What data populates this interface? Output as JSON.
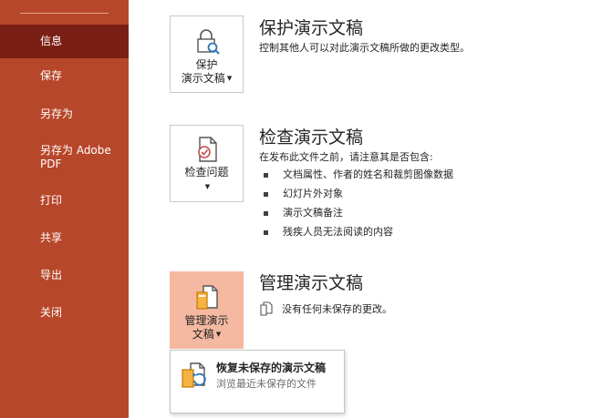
{
  "sidebar": {
    "items": [
      {
        "label": "信息"
      },
      {
        "label": "保存"
      },
      {
        "label": "另存为"
      },
      {
        "label": "另存为 Adobe PDF"
      },
      {
        "label": "打印"
      },
      {
        "label": "共享"
      },
      {
        "label": "导出"
      },
      {
        "label": "关闭"
      }
    ],
    "active": "信息"
  },
  "protect": {
    "button_line1": "保护",
    "button_line2": "演示文稿",
    "title": "保护演示文稿",
    "desc": "控制其他人可以对此演示文稿所做的更改类型。"
  },
  "inspect": {
    "button_label": "检查问题",
    "title": "检查演示文稿",
    "desc": "在发布此文件之前，请注意其是否包含:",
    "bullets": [
      "文档属性、作者的姓名和裁剪图像数据",
      "幻灯片外对象",
      "演示文稿备注",
      "残疾人员无法阅读的内容"
    ]
  },
  "manage": {
    "button_line1": "管理演示",
    "button_line2": "文稿",
    "title": "管理演示文稿",
    "desc": "没有任何未保存的更改。"
  },
  "dropdown": {
    "item_title": "恢复未保存的演示文稿",
    "item_sub": "浏览最近未保存的文件"
  },
  "colors": {
    "sidebar_bg": "#b7472a",
    "sidebar_active": "#7a1f15",
    "tile_selected": "#f4b9a0"
  }
}
